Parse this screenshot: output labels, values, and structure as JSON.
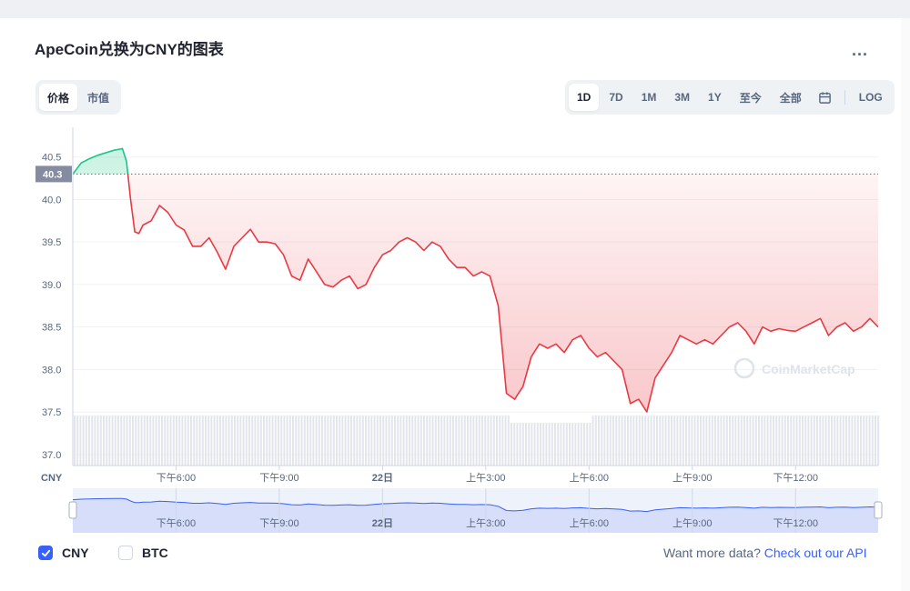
{
  "header": {
    "title": "ApeCoin兑换为CNY的图表",
    "more_label": "..."
  },
  "type_tabs": [
    {
      "label": "价格",
      "active": true
    },
    {
      "label": "市值",
      "active": false
    }
  ],
  "range_tabs": [
    {
      "label": "1D",
      "active": true
    },
    {
      "label": "7D",
      "active": false
    },
    {
      "label": "1M",
      "active": false
    },
    {
      "label": "3M",
      "active": false
    },
    {
      "label": "1Y",
      "active": false
    },
    {
      "label": "至今",
      "active": false
    },
    {
      "label": "全部",
      "active": false
    }
  ],
  "log_label": "LOG",
  "legend": {
    "items": [
      {
        "label": "CNY",
        "checked": true
      },
      {
        "label": "BTC",
        "checked": false
      }
    ]
  },
  "more_data": {
    "prefix": "Want more data?",
    "link": "Check out our API"
  },
  "watermark": "CoinMarketCap",
  "colors": {
    "up": "#16c784",
    "down": "#ea3943",
    "accent": "#3861fb"
  },
  "chart_data": {
    "type": "line",
    "xlabel": "",
    "ylabel": "CNY",
    "ylim": [
      36.87,
      40.85
    ],
    "yticks": [
      37.0,
      37.5,
      38.0,
      38.5,
      39.0,
      39.5,
      40.0,
      40.5
    ],
    "ytick_labels": [
      "37.0",
      "37.5",
      "38.0",
      "38.5",
      "39.0",
      "39.5",
      "40.0",
      "40.5"
    ],
    "reference_value": 40.3,
    "reference_label": "40.3",
    "xlim": [
      -1.5,
      18.0
    ],
    "x_ticks": [
      {
        "x": 1.0,
        "label": "下午6:00"
      },
      {
        "x": 3.5,
        "label": "下午9:00"
      },
      {
        "x": 6.0,
        "label": "22日"
      },
      {
        "x": 8.5,
        "label": "上午3:00"
      },
      {
        "x": 11.0,
        "label": "上午6:00"
      },
      {
        "x": 13.5,
        "label": "上午9:00"
      },
      {
        "x": 16.0,
        "label": "下午12:00"
      }
    ],
    "series": [
      {
        "x": [
          -1.5,
          -1.3,
          -1.1,
          -0.9,
          -0.7,
          -0.5,
          -0.3,
          -0.2,
          -0.1,
          0.0,
          0.1,
          0.2,
          0.4,
          0.6,
          0.8,
          1.0,
          1.2,
          1.4,
          1.6,
          1.8,
          2.0,
          2.2,
          2.4,
          2.6,
          2.8,
          3.0,
          3.2,
          3.4,
          3.6,
          3.8,
          4.0,
          4.2,
          4.4,
          4.6,
          4.8,
          5.0,
          5.2,
          5.4,
          5.6,
          5.8,
          6.0,
          6.2,
          6.4,
          6.6,
          6.8,
          7.0,
          7.2,
          7.4,
          7.6,
          7.8,
          8.0,
          8.2,
          8.4,
          8.6,
          8.8,
          9.0,
          9.2,
          9.4,
          9.6,
          9.8,
          10.0,
          10.2,
          10.4,
          10.6,
          10.8,
          11.0,
          11.2,
          11.4,
          11.6,
          11.8,
          12.0,
          12.2,
          12.4,
          12.6,
          12.8,
          13.0,
          13.2,
          13.4,
          13.6,
          13.8,
          14.0,
          14.2,
          14.4,
          14.6,
          14.8,
          15.0,
          15.2,
          15.4,
          15.6,
          15.8,
          16.0,
          16.2,
          16.4,
          16.6,
          16.8,
          17.0,
          17.2,
          17.4,
          17.6,
          17.8,
          18.0
        ],
        "values": [
          40.3,
          40.43,
          40.48,
          40.52,
          40.55,
          40.58,
          40.6,
          40.45,
          40.0,
          39.62,
          39.6,
          39.7,
          39.75,
          39.93,
          39.85,
          39.7,
          39.64,
          39.45,
          39.45,
          39.55,
          39.38,
          39.18,
          39.45,
          39.55,
          39.65,
          39.5,
          39.5,
          39.48,
          39.35,
          39.1,
          39.05,
          39.3,
          39.15,
          39.0,
          38.97,
          39.05,
          39.1,
          38.95,
          39.0,
          39.2,
          39.35,
          39.4,
          39.5,
          39.55,
          39.5,
          39.4,
          39.5,
          39.45,
          39.3,
          39.2,
          39.2,
          39.1,
          39.15,
          39.1,
          38.75,
          37.72,
          37.65,
          37.8,
          38.15,
          38.3,
          38.25,
          38.3,
          38.2,
          38.35,
          38.4,
          38.25,
          38.15,
          38.2,
          38.1,
          38.0,
          37.6,
          37.65,
          37.5,
          37.9,
          38.05,
          38.2,
          38.4,
          38.35,
          38.3,
          38.35,
          38.3,
          38.4,
          38.5,
          38.55,
          38.45,
          38.3,
          38.5,
          38.45,
          38.48,
          38.46,
          38.45,
          38.5,
          38.55,
          38.6,
          38.4,
          38.5,
          38.55,
          38.45,
          38.5,
          38.6,
          38.5
        ]
      }
    ]
  }
}
